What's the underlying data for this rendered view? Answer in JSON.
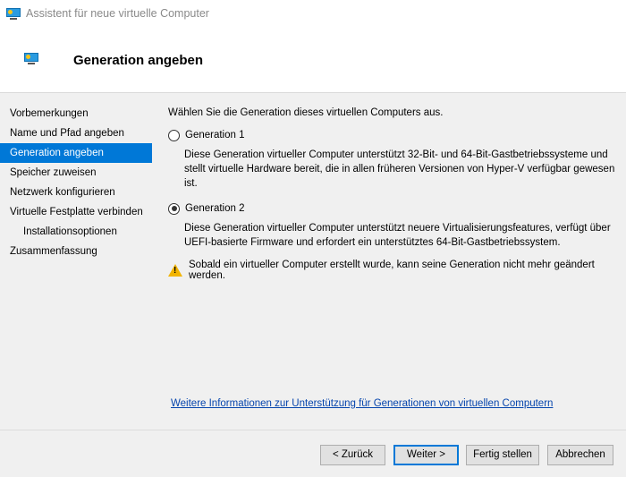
{
  "window": {
    "title": "Assistent für neue virtuelle Computer"
  },
  "header": {
    "title": "Generation angeben"
  },
  "sidebar": {
    "items": [
      {
        "label": "Vorbemerkungen"
      },
      {
        "label": "Name und Pfad angeben"
      },
      {
        "label": "Generation angeben",
        "active": true
      },
      {
        "label": "Speicher zuweisen"
      },
      {
        "label": "Netzwerk konfigurieren"
      },
      {
        "label": "Virtuelle Festplatte verbinden"
      },
      {
        "label": "Installationsoptionen",
        "sub": true
      },
      {
        "label": "Zusammenfassung"
      }
    ]
  },
  "main": {
    "intro": "Wählen Sie die Generation dieses virtuellen Computers aus.",
    "options": [
      {
        "label": "Generation 1",
        "selected": false,
        "description": "Diese Generation virtueller Computer unterstützt 32-Bit- und 64-Bit-Gastbetriebssysteme und stellt virtuelle Hardware bereit, die in allen früheren Versionen von Hyper-V verfügbar gewesen ist."
      },
      {
        "label": "Generation 2",
        "selected": true,
        "description": "Diese Generation virtueller Computer unterstützt neuere Virtualisierungsfeatures, verfügt über UEFI-basierte Firmware und erfordert ein unterstütztes 64-Bit-Gastbetriebssystem."
      }
    ],
    "warning": "Sobald ein virtueller Computer erstellt wurde, kann seine Generation nicht mehr geändert werden.",
    "link": "Weitere Informationen zur Unterstützung für Generationen von virtuellen Computern"
  },
  "buttons": {
    "back": "< Zurück",
    "next": "Weiter >",
    "finish": "Fertig stellen",
    "cancel": "Abbrechen"
  }
}
